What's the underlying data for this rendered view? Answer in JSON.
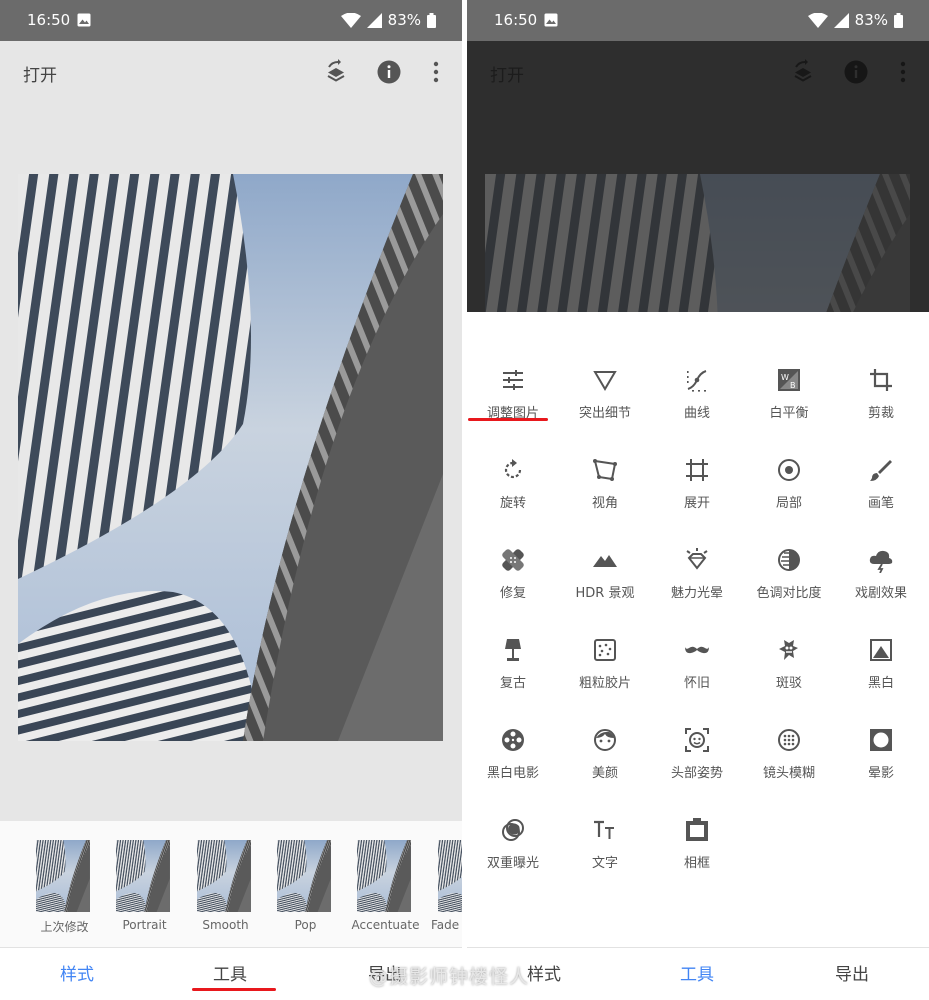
{
  "status_bar": {
    "time": "16:50",
    "battery": "83%"
  },
  "app_bar": {
    "open_label": "打开"
  },
  "looks": [
    {
      "label": "上次修改"
    },
    {
      "label": "Portrait"
    },
    {
      "label": "Smooth"
    },
    {
      "label": "Pop"
    },
    {
      "label": "Accentuate"
    },
    {
      "label": "Fade"
    }
  ],
  "bottom_nav": {
    "styles": "样式",
    "tools": "工具",
    "export": "导出"
  },
  "tools": [
    {
      "label": "调整图片",
      "icon": "tune-icon"
    },
    {
      "label": "突出细节",
      "icon": "details-triangle-icon"
    },
    {
      "label": "曲线",
      "icon": "curves-icon"
    },
    {
      "label": "白平衡",
      "icon": "white-balance-icon"
    },
    {
      "label": "剪裁",
      "icon": "crop-icon"
    },
    {
      "label": "旋转",
      "icon": "rotate-icon"
    },
    {
      "label": "视角",
      "icon": "perspective-icon"
    },
    {
      "label": "展开",
      "icon": "expand-icon"
    },
    {
      "label": "局部",
      "icon": "selective-icon"
    },
    {
      "label": "画笔",
      "icon": "brush-icon"
    },
    {
      "label": "修复",
      "icon": "healing-icon"
    },
    {
      "label": "HDR 景观",
      "icon": "hdr-mountain-icon"
    },
    {
      "label": "魅力光晕",
      "icon": "glamour-glow-icon"
    },
    {
      "label": "色调对比度",
      "icon": "tonal-contrast-icon"
    },
    {
      "label": "戏剧效果",
      "icon": "drama-cloud-icon"
    },
    {
      "label": "复古",
      "icon": "vintage-lamp-icon"
    },
    {
      "label": "粗粒胶片",
      "icon": "grainy-film-icon"
    },
    {
      "label": "怀旧",
      "icon": "mustache-icon"
    },
    {
      "label": "斑驳",
      "icon": "grunge-icon"
    },
    {
      "label": "黑白",
      "icon": "black-white-icon"
    },
    {
      "label": "黑白电影",
      "icon": "film-reel-icon"
    },
    {
      "label": "美颜",
      "icon": "face-icon"
    },
    {
      "label": "头部姿势",
      "icon": "head-pose-icon"
    },
    {
      "label": "镜头模糊",
      "icon": "lens-blur-icon"
    },
    {
      "label": "晕影",
      "icon": "vignette-icon"
    },
    {
      "label": "双重曝光",
      "icon": "double-exposure-icon"
    },
    {
      "label": "文字",
      "icon": "text-icon"
    },
    {
      "label": "相框",
      "icon": "frames-icon"
    }
  ],
  "watermark": "@摄影师钟楼怪人",
  "colors": {
    "accent": "#4285f4",
    "highlight": "#e8181d",
    "status_bar": "#6b6b6b"
  }
}
